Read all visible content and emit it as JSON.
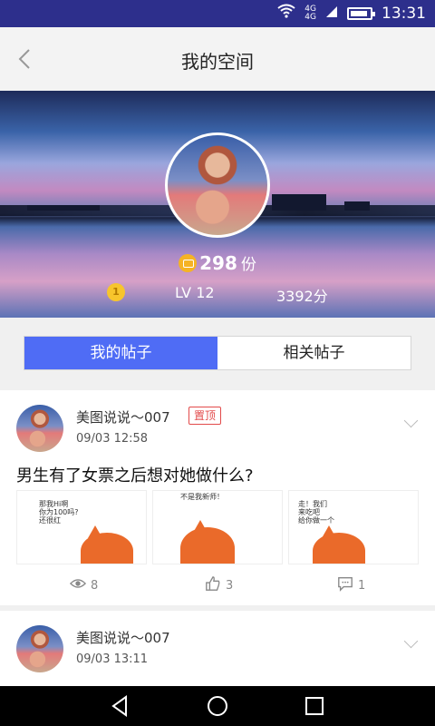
{
  "status": {
    "network_top": "4G",
    "network_bottom": "4G",
    "time": "13:31"
  },
  "header": {
    "title": "我的空间"
  },
  "profile": {
    "points": "298",
    "points_unit": "份",
    "coin_level": "1",
    "level": "LV 12",
    "score": "3392分"
  },
  "tabs": [
    {
      "label": "我的帖子",
      "active": true
    },
    {
      "label": "相关帖子",
      "active": false
    }
  ],
  "posts": [
    {
      "author": "美图说说～007",
      "badge": "置顶",
      "time": "09/03 12:58",
      "text": "男生有了女票之后想对她做什么?",
      "thumbs": [
        {
          "speech": "那我Hi啊\n你为100吗?\n还很红"
        },
        {
          "speech": "不是我新师！"
        },
        {
          "speech": "走！我们\n来吃吧\n给你做一个"
        }
      ],
      "views": "8",
      "likes": "3",
      "comments": "1"
    },
    {
      "author": "美图说说～007",
      "time": "09/03 13:11"
    }
  ],
  "colors": {
    "accent": "#4f6cf5",
    "badge": "#e24a4a",
    "coin": "#f5b324",
    "statusbar": "#2d2f8c"
  }
}
